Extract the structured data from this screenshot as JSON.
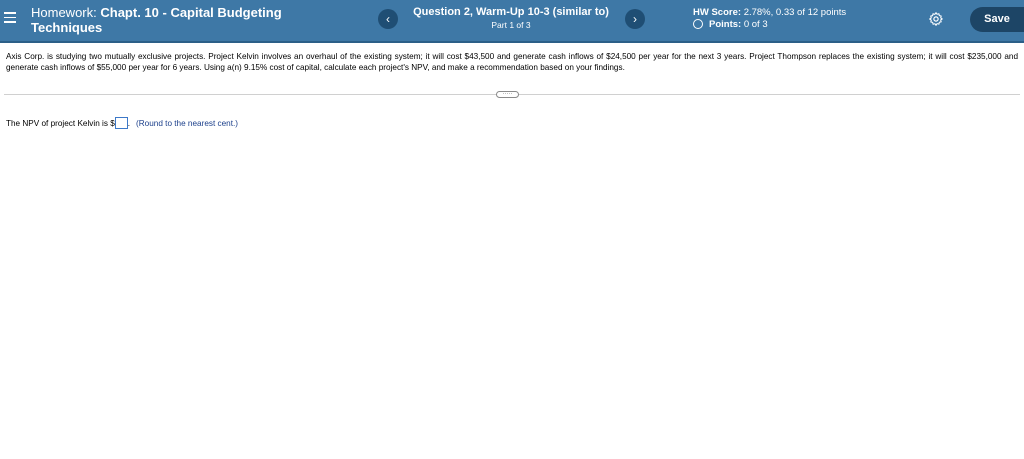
{
  "header": {
    "title_prefix": "Homework:",
    "title_main": "Chapt. 10 - Capital Budgeting",
    "title_line2": "Techniques",
    "prev_glyph": "‹",
    "next_glyph": "›",
    "question_title": "Question 2, Warm-Up 10-3 (similar to)",
    "question_part": "Part 1 of 3",
    "score_label": "HW Score:",
    "score_value": "2.78%, 0.33 of 12 points",
    "points_label": "Points:",
    "points_value": "0 of 3",
    "save_label": "Save",
    "colors": {
      "bar": "#3e78a6",
      "dark": "#1d4566"
    }
  },
  "problem": {
    "text": "Axis Corp. is studying two mutually exclusive projects. Project Kelvin involves an overhaul of the existing system; it will cost $43,500 and generate cash inflows of $24,500 per year for the next 3 years. Project Thompson replaces the existing system; it will cost $235,000 and generate cash inflows of $55,000 per year for 6 years. Using a(n) 9.15% cost of capital, calculate each project's NPV, and make a recommendation based on your findings."
  },
  "expand_glyph": "·····",
  "answer": {
    "prefix": "The NPV of project Kelvin is $",
    "value": "",
    "suffix": ".",
    "hint": "(Round to the nearest cent.)"
  }
}
